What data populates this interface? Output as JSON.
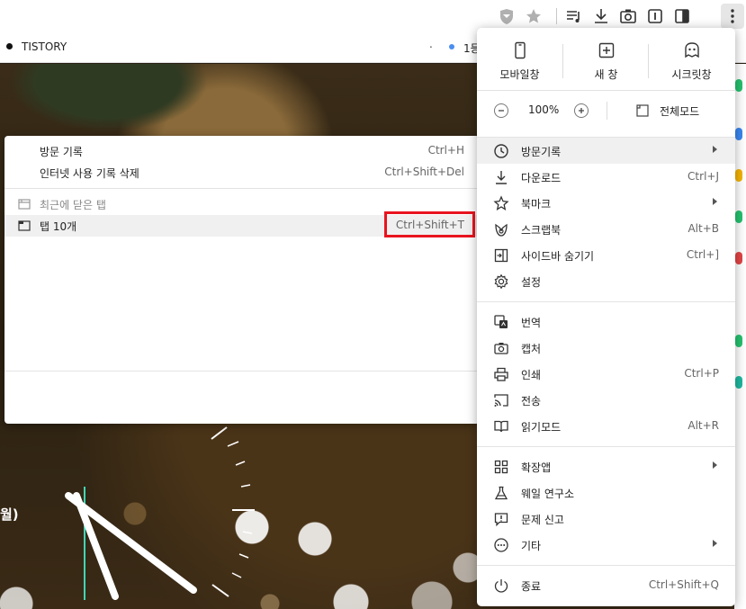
{
  "bookmarks": {
    "tistory": "TISTORY",
    "dot_label": ".",
    "trailing": "1등"
  },
  "history_submenu": {
    "items": [
      {
        "label": "방문 기록",
        "shortcut": "Ctrl+H"
      },
      {
        "label": "인터넷 사용 기록 삭제",
        "shortcut": "Ctrl+Shift+Del"
      }
    ],
    "recent_closed_label": "최근에 닫은 탭",
    "tabs_label": "탭 10개",
    "tabs_shortcut": "Ctrl+Shift+T"
  },
  "page": {
    "partial_text": "월)"
  },
  "menu": {
    "quick": [
      {
        "label": "모바일창",
        "icon": "mobile-icon"
      },
      {
        "label": "새 창",
        "icon": "new-window-icon"
      },
      {
        "label": "시크릿창",
        "icon": "incognito-icon"
      }
    ],
    "zoom": {
      "value": "100%",
      "fullscreen_label": "전체모드"
    },
    "groups": [
      [
        {
          "label": "방문기록",
          "shortcut": "",
          "submenu": true,
          "icon": "history-icon"
        },
        {
          "label": "다운로드",
          "shortcut": "Ctrl+J",
          "submenu": false,
          "icon": "download-icon"
        },
        {
          "label": "북마크",
          "shortcut": "",
          "submenu": true,
          "icon": "star-icon"
        },
        {
          "label": "스크랩북",
          "shortcut": "Alt+B",
          "submenu": false,
          "icon": "scrapbook-icon"
        },
        {
          "label": "사이드바 숨기기",
          "shortcut": "Ctrl+]",
          "submenu": false,
          "icon": "sidebar-icon"
        },
        {
          "label": "설정",
          "shortcut": "",
          "submenu": false,
          "icon": "gear-icon"
        }
      ],
      [
        {
          "label": "번역",
          "shortcut": "",
          "submenu": false,
          "icon": "translate-icon"
        },
        {
          "label": "캡처",
          "shortcut": "",
          "submenu": false,
          "icon": "camera-icon"
        },
        {
          "label": "인쇄",
          "shortcut": "Ctrl+P",
          "submenu": false,
          "icon": "print-icon"
        },
        {
          "label": "전송",
          "shortcut": "",
          "submenu": false,
          "icon": "cast-icon"
        },
        {
          "label": "읽기모드",
          "shortcut": "Alt+R",
          "submenu": false,
          "icon": "book-icon"
        }
      ],
      [
        {
          "label": "확장앱",
          "shortcut": "",
          "submenu": true,
          "icon": "extensions-icon"
        },
        {
          "label": "웨일 연구소",
          "shortcut": "",
          "submenu": false,
          "icon": "flask-icon"
        },
        {
          "label": "문제 신고",
          "shortcut": "",
          "submenu": false,
          "icon": "report-icon"
        },
        {
          "label": "기타",
          "shortcut": "",
          "submenu": true,
          "icon": "more-icon"
        }
      ],
      [
        {
          "label": "종료",
          "shortcut": "Ctrl+Shift+Q",
          "submenu": false,
          "icon": "power-icon"
        }
      ]
    ]
  },
  "colors": {
    "highlight": "#e8141e",
    "accent_line": "#3fd6b5"
  }
}
